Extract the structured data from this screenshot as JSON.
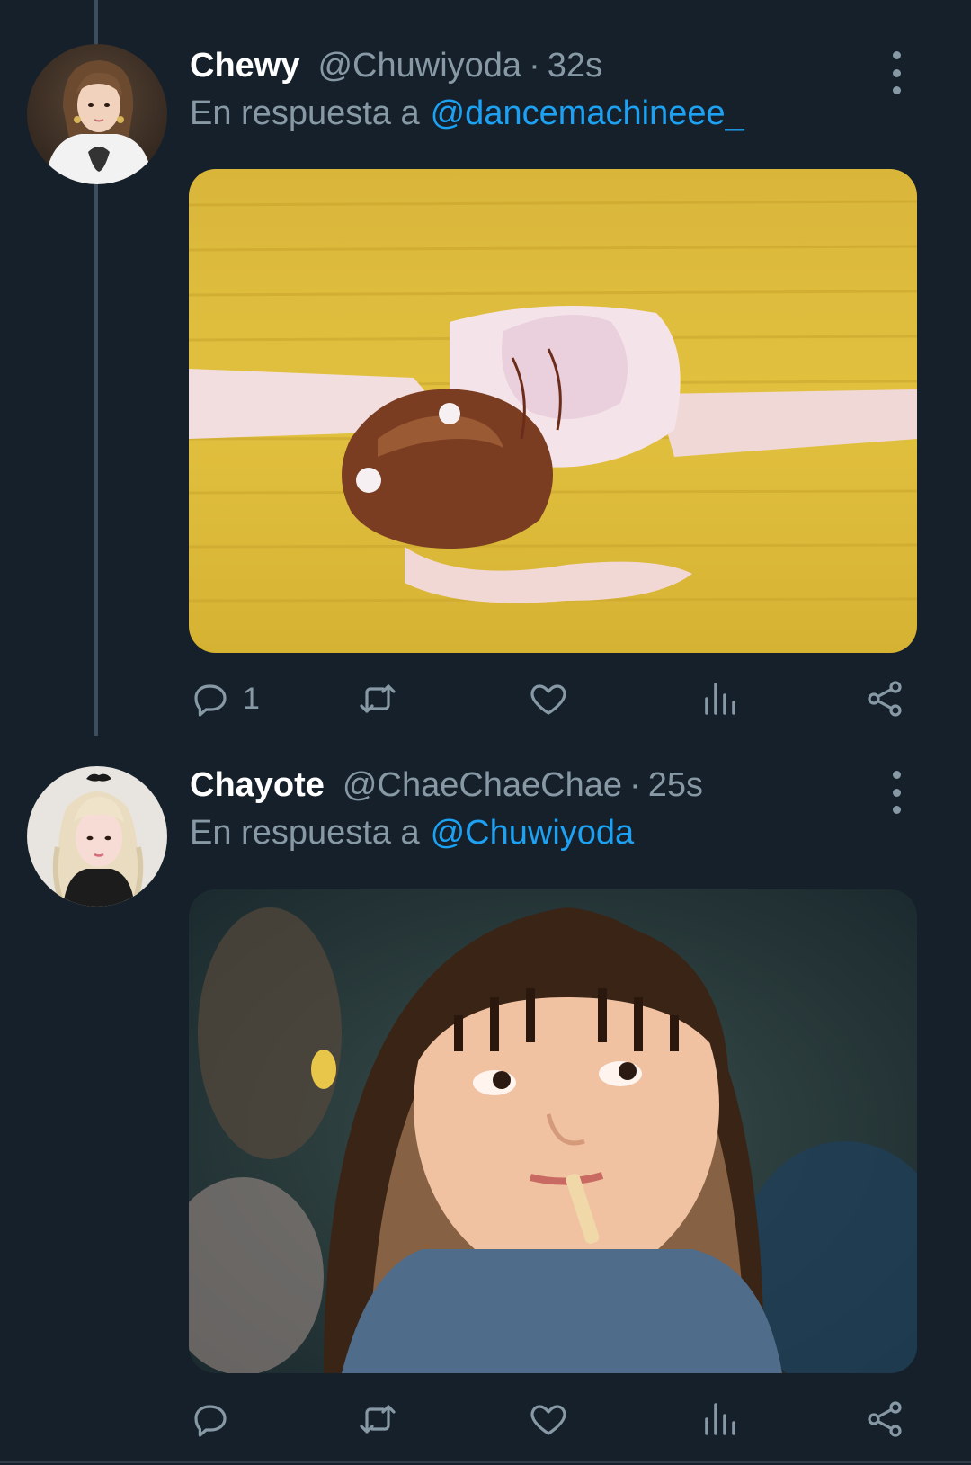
{
  "tweets": [
    {
      "display_name": "Chewy",
      "handle": "@Chuwiyoda",
      "separator": "·",
      "time": "32s",
      "reply_prefix": "En respuesta a",
      "reply_to": "@dancemachineee_",
      "reply_count": "1",
      "media": "photo",
      "avatar": "avatar"
    },
    {
      "display_name": "Chayote",
      "handle": "@ChaeChaeChae",
      "separator": "·",
      "time": "25s",
      "reply_prefix": "En respuesta a",
      "reply_to": "@Chuwiyoda",
      "reply_count": "",
      "media": "photo",
      "avatar": "avatar"
    }
  ],
  "icons": {
    "reply": "reply-icon",
    "retweet": "retweet-icon",
    "like": "heart-icon",
    "stats": "analytics-icon",
    "share": "share-icon",
    "more": "more-vertical-icon"
  },
  "colors": {
    "background": "#15202b",
    "text_primary": "#ffffff",
    "text_secondary": "#8899a6",
    "link": "#1da1f2",
    "thread_line": "#3d4f5e"
  }
}
